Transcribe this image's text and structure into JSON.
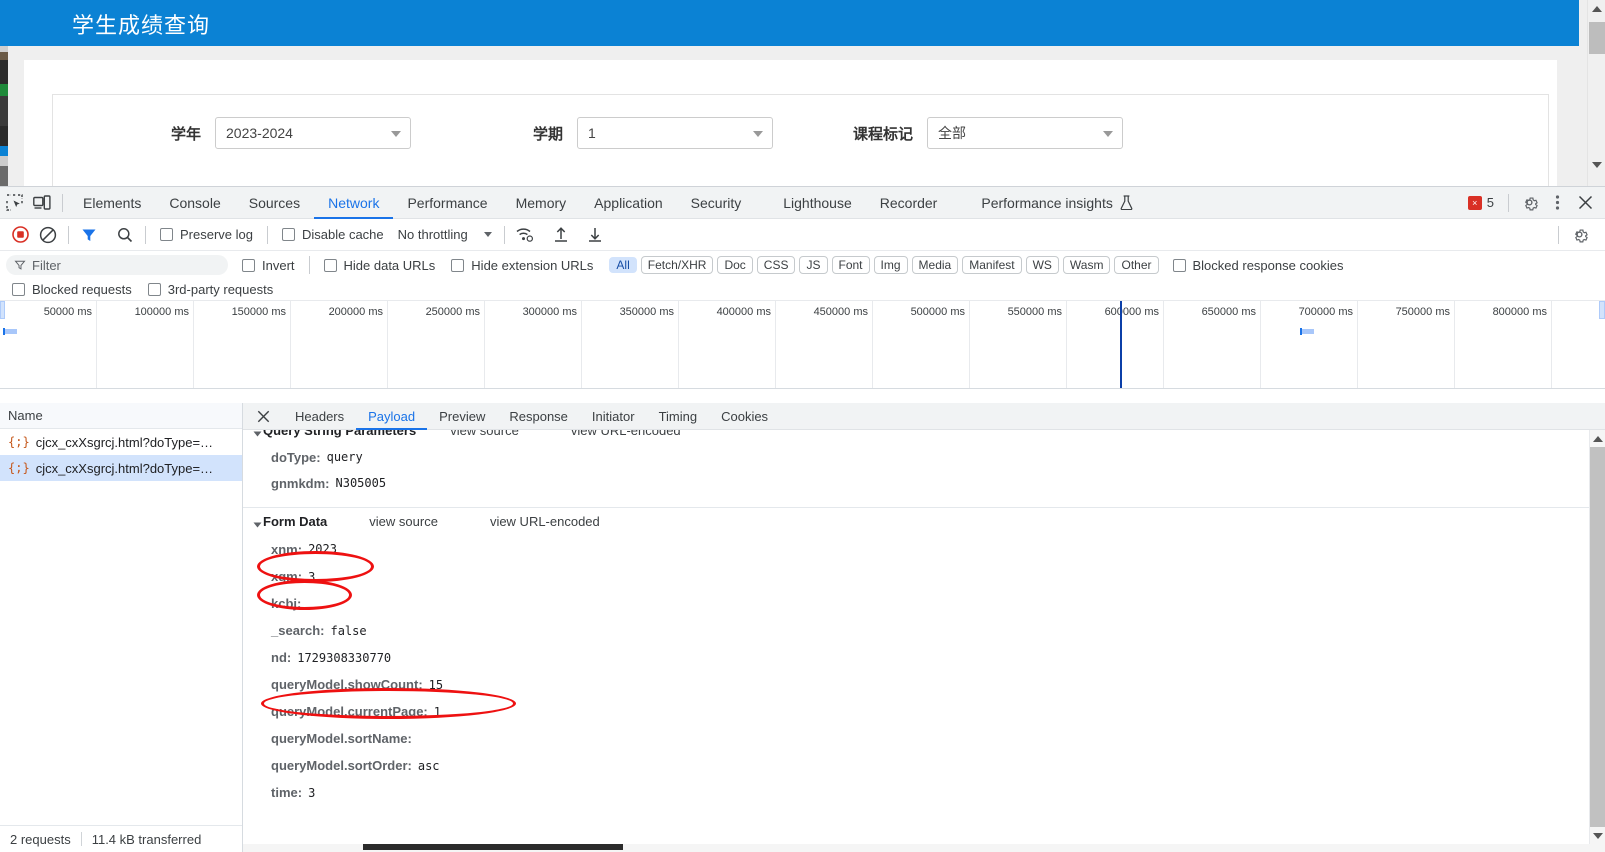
{
  "webpage": {
    "title": "学生成绩查询",
    "header_color": "#0b82d4",
    "fields": [
      {
        "label": "学年",
        "value": "2023-2024",
        "icon": "chevron-down-icon"
      },
      {
        "label": "学期",
        "value": "1",
        "icon": "chevron-down-icon"
      },
      {
        "label": "课程标记",
        "value": "全部",
        "icon": "chevron-down-icon"
      }
    ]
  },
  "devtools": {
    "main_tabs": [
      {
        "label": "Elements",
        "active": false
      },
      {
        "label": "Console",
        "active": false
      },
      {
        "label": "Sources",
        "active": false
      },
      {
        "label": "Network",
        "active": true
      },
      {
        "label": "Performance",
        "active": false
      },
      {
        "label": "Memory",
        "active": false
      },
      {
        "label": "Application",
        "active": false
      },
      {
        "label": "Security",
        "active": false
      },
      {
        "label": "Lighthouse",
        "active": false
      },
      {
        "label": "Recorder",
        "active": false
      },
      {
        "label": "Performance insights",
        "active": false
      }
    ],
    "inspect_icon": "inspect-element-icon",
    "device_icon": "device-toolbar-icon",
    "flask_icon": "flask-icon",
    "error_badge": {
      "count": "5",
      "icon": "error-icon"
    },
    "settings_icon": "gear-icon",
    "more_icon": "more-vertical-icon",
    "close_icon": "close-icon",
    "network_toolbar": {
      "record_icon": "record-stop-icon",
      "clear_icon": "clear-icon",
      "filter_icon": "filter-icon",
      "search_icon": "search-icon",
      "preserve_log": "Preserve log",
      "disable_cache": "Disable cache",
      "throttling": "No throttling",
      "wifi_icon": "network-conditions-icon",
      "upload_icon": "import-har-icon",
      "download_icon": "export-har-icon",
      "settings_icon": "gear-icon"
    },
    "filter_bar": {
      "placeholder": "Filter",
      "filter_icon": "filter-icon",
      "invert": "Invert",
      "hide_data_urls": "Hide data URLs",
      "hide_extension_urls": "Hide extension URLs",
      "types": [
        "All",
        "Fetch/XHR",
        "Doc",
        "CSS",
        "JS",
        "Font",
        "Img",
        "Media",
        "Manifest",
        "WS",
        "Wasm",
        "Other"
      ],
      "active_type": "All",
      "blocked_response_cookies": "Blocked response cookies"
    },
    "blocked_bar": {
      "blocked_requests": "Blocked requests",
      "third_party_requests": "3rd-party requests"
    },
    "timeline": {
      "ticks": [
        "50000 ms",
        "100000 ms",
        "150000 ms",
        "200000 ms",
        "250000 ms",
        "300000 ms",
        "350000 ms",
        "400000 ms",
        "450000 ms",
        "500000 ms",
        "550000 ms",
        "600000 ms",
        "650000 ms",
        "700000 ms",
        "750000 ms",
        "800000 ms"
      ],
      "playhead_label": "600000 ms"
    },
    "request_list": {
      "column_header": "Name",
      "rows": [
        {
          "name": "cjcx_cxXsgrcj.html?doType=…",
          "icon": "json-icon",
          "selected": false
        },
        {
          "name": "cjcx_cxXsgrcj.html?doType=…",
          "icon": "json-icon",
          "selected": true
        }
      ],
      "status": {
        "requests": "2 requests",
        "transferred": "11.4 kB transferred"
      }
    },
    "detail_tabs": [
      {
        "label": "Headers",
        "active": false
      },
      {
        "label": "Payload",
        "active": true
      },
      {
        "label": "Preview",
        "active": false
      },
      {
        "label": "Response",
        "active": false
      },
      {
        "label": "Initiator",
        "active": false
      },
      {
        "label": "Timing",
        "active": false
      },
      {
        "label": "Cookies",
        "active": false
      }
    ],
    "detail_close_icon": "close-icon",
    "payload": {
      "query_string": {
        "title": "Query String Parameters",
        "view_source": "view source",
        "view_url_encoded": "view URL-encoded",
        "rows": [
          {
            "key": "doType:",
            "value": "query"
          },
          {
            "key": "gnmkdm:",
            "value": "N305005"
          }
        ]
      },
      "form_data": {
        "title": "Form Data",
        "view_source": "view source",
        "view_url_encoded": "view URL-encoded",
        "rows": [
          {
            "key": "xnm:",
            "value": "2023",
            "highlighted": true
          },
          {
            "key": "xqm:",
            "value": "3",
            "highlighted": true
          },
          {
            "key": "kcbj:",
            "value": ""
          },
          {
            "key": "_search:",
            "value": "false"
          },
          {
            "key": "nd:",
            "value": "1729308330770"
          },
          {
            "key": "queryModel.showCount:",
            "value": "15",
            "highlighted": true
          },
          {
            "key": "queryModel.currentPage:",
            "value": "1"
          },
          {
            "key": "queryModel.sortName:",
            "value": ""
          },
          {
            "key": "queryModel.sortOrder:",
            "value": "asc"
          },
          {
            "key": "time:",
            "value": "3"
          }
        ]
      }
    },
    "annotation_color": "#ee1111"
  }
}
